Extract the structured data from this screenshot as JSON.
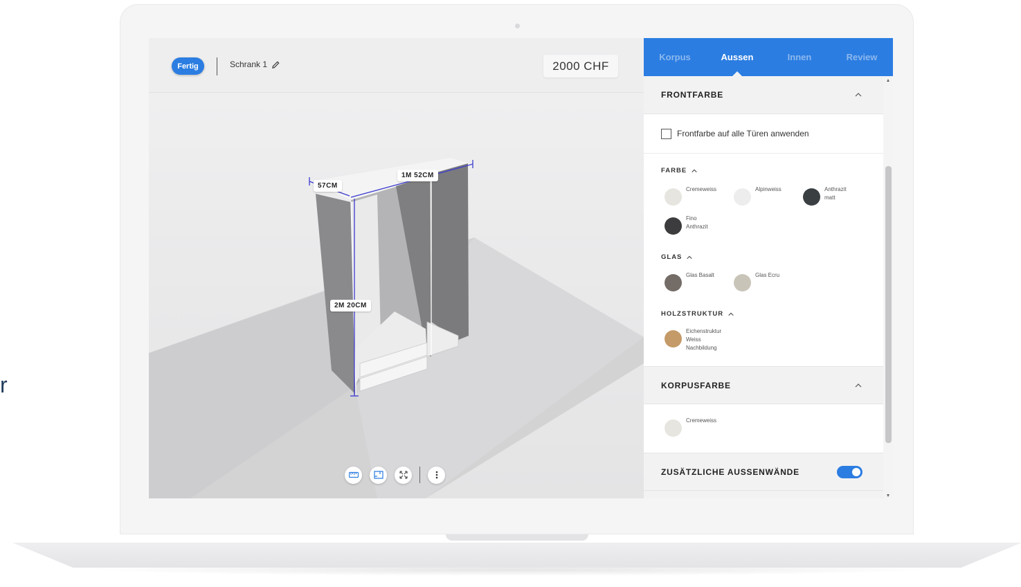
{
  "page": {
    "stray_text": "r"
  },
  "viewport": {
    "done_button": "Fertig",
    "project_name": "Schrank 1",
    "price": "2000 CHF",
    "dimensions": {
      "depth": "57CM",
      "width": "1M 52CM",
      "height": "2M 20CM"
    },
    "tools": [
      "ruler-icon",
      "floorplan-icon",
      "fullscreen-icon",
      "more-icon"
    ]
  },
  "panel": {
    "tabs": [
      {
        "label": "Korpus",
        "active": false
      },
      {
        "label": "Aussen",
        "active": true
      },
      {
        "label": "Innen",
        "active": false
      },
      {
        "label": "Review",
        "active": false
      }
    ],
    "frontfarbe": {
      "title": "FRONTFARBE",
      "apply_all_label": "Frontfarbe auf alle Türen anwenden",
      "groups": [
        {
          "title": "FARBE",
          "swatches": [
            {
              "label": "Cremeweiss",
              "color": "#e6e5df"
            },
            {
              "label": "Alpinweiss",
              "color": "#ededed"
            },
            {
              "label": "Anthrazit\nmatt",
              "color": "#3a3f42"
            },
            {
              "label": "Fino\nAnthrazit",
              "color": "#3c3b3d"
            }
          ]
        },
        {
          "title": "GLAS",
          "swatches": [
            {
              "label": "Glas Basalt",
              "color": "#746c67"
            },
            {
              "label": "Glas Ecru",
              "color": "#c9c4b8"
            }
          ]
        },
        {
          "title": "HOLZSTRUKTUR",
          "swatches": [
            {
              "label": "Eichenstruktur\nWeiss\nNachbildung",
              "color": "#c49a68"
            }
          ]
        }
      ]
    },
    "korpusfarbe": {
      "title": "KORPUSFARBE",
      "swatches": [
        {
          "label": "Cremeweiss",
          "color": "#e6e5df"
        }
      ]
    },
    "aussenwaende": {
      "title": "ZUSÄTZLICHE AUSSENWÄNDE",
      "enabled": true
    }
  },
  "colors": {
    "accent": "#2b7de1",
    "dimension_line": "#3b3bd0"
  }
}
